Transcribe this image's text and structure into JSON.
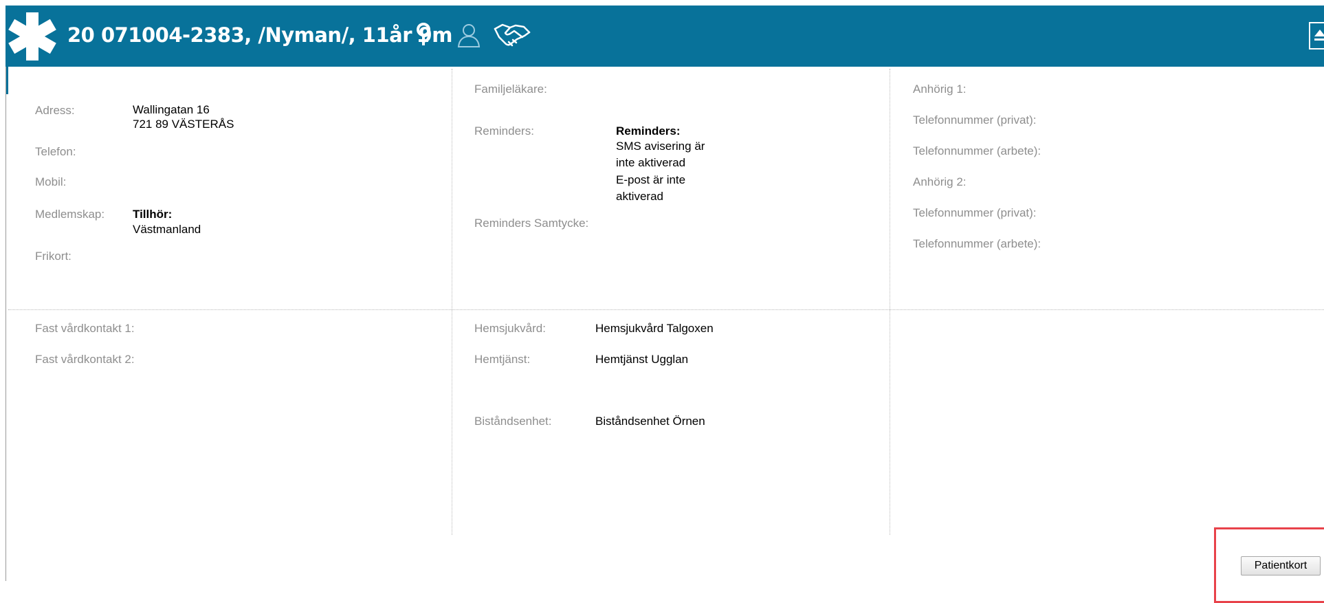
{
  "header": {
    "title": "20 071004-2383,  /Nyman/,  11år 9m",
    "icons": [
      "star-of-life-icon",
      "female-icon",
      "person-outline-icon",
      "handshake-icon",
      "collapse-icon"
    ],
    "colors": {
      "bar": "#08729a",
      "text": "#ffffff",
      "highlight": "#e8424a"
    }
  },
  "personal": {
    "address_label": "Adress:",
    "address_line1": "Wallingatan 16",
    "address_line2": "721 89 VÄSTERÅS",
    "phone_label": "Telefon:",
    "mobile_label": "Mobil:",
    "membership_label": "Medlemskap:",
    "membership_title": "Tillhör:",
    "membership_value": "Västmanland",
    "frikort_label": "Frikort:"
  },
  "reminders": {
    "family_doctor_label": "Familjeläkare:",
    "reminders_label": "Reminders:",
    "reminders_title": "Reminders:",
    "reminders_lines": [
      "SMS avisering är",
      "inte aktiverad",
      "E-post är inte",
      "aktiverad"
    ],
    "consent_label": "Reminders Samtycke:"
  },
  "relatives": {
    "relative1_label": "Anhörig 1:",
    "phone_private_1": "Telefonnummer (privat):",
    "phone_work_1": "Telefonnummer (arbete):",
    "relative2_label": "Anhörig 2:",
    "phone_private_2": "Telefonnummer (privat):",
    "phone_work_2": "Telefonnummer (arbete):"
  },
  "care_contacts": {
    "contact1_label": "Fast vårdkontakt 1:",
    "contact2_label": "Fast vårdkontakt 2:"
  },
  "services": {
    "home_care_label": "Hemsjukvård:",
    "home_care_value": "Hemsjukvård Talgoxen",
    "home_service_label": "Hemtjänst:",
    "home_service_value": "Hemtjänst Ugglan",
    "assistance_unit_label": "Biståndsenhet:",
    "assistance_unit_value": "Biståndsenhet Örnen"
  },
  "actions": {
    "patient_card_label": "Patientkort"
  }
}
